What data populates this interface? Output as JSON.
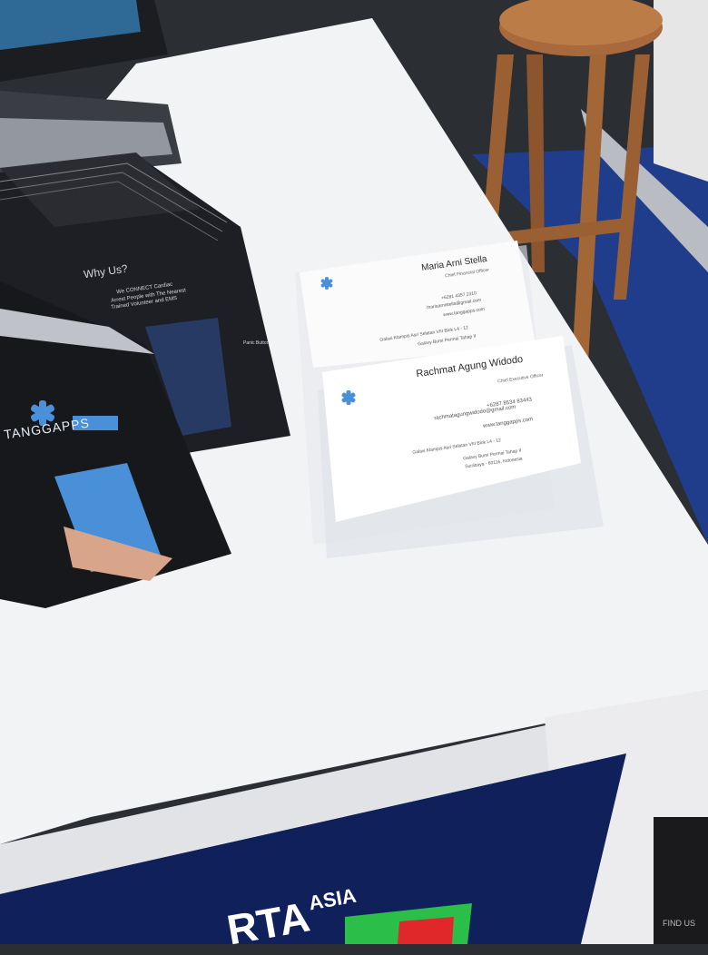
{
  "scene": {
    "description_colors": {
      "floor": "#2b2e33",
      "carpet": "#1f3d8a",
      "table_top": "#f2f3f5",
      "stool": "#a86a3c",
      "brochure": "#1d1f24",
      "accent_blue": "#4a90d9"
    }
  },
  "brochure": {
    "heading": "Why Us?",
    "tagline_1": "We CONNECT Cardiac",
    "tagline_2": "Arrest People with The Nearest",
    "tagline_3": "Trained Volunteer and EMS",
    "panic_button": "Panic Button",
    "brand": "TANGGAPPS"
  },
  "card_back": {
    "name": "Maria Arni Stella",
    "title": "Chief Financial Officer",
    "phone": "+6281 4357 2310",
    "email": "mariaarnistella@gmail.com",
    "web": "www.tanggapps.com",
    "address_1": "Galaxi Klampis Asri Selatan VIII Blok L4 - 12",
    "address_2": "Galaxy Bumi Permai Tahap II"
  },
  "card_front": {
    "name": "Rachmat Agung Widodo",
    "title": "Chief Executive Officer",
    "phone": "+6287 8534 83443",
    "email": "rachmatagungwidodo@gmail.com",
    "web": "www.tanggapps.com",
    "address_1": "Galaxi Klampis Asri Selatan VIII Blok L4 - 12",
    "address_2": "Galaxy Bumi Permai Tahap II",
    "address_3": "Surabaya - 60116, Indonesia"
  },
  "banner": {
    "text_1": "ASIA",
    "text_2": "RTA",
    "text_3": "FIND US"
  }
}
